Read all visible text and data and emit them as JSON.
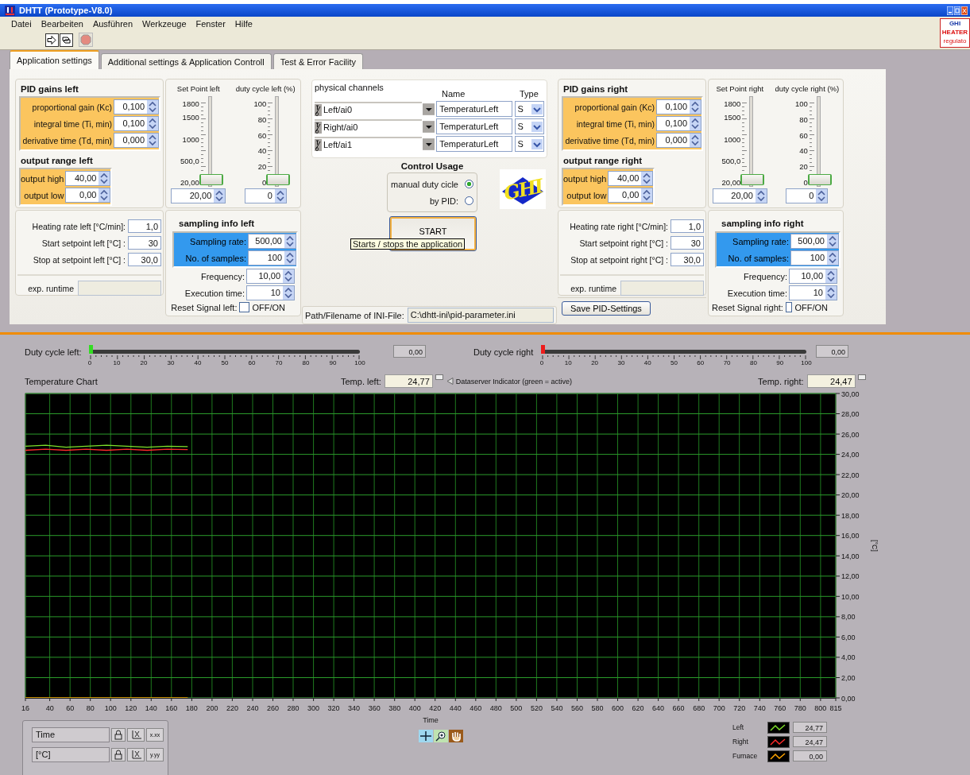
{
  "window": {
    "title": "DHTT (Prototype-V8.0)"
  },
  "menu": [
    "Datei",
    "Bearbeiten",
    "Ausführen",
    "Werkzeuge",
    "Fenster",
    "Hilfe"
  ],
  "corner_logo": {
    "lines": [
      "GHI",
      "HEATER",
      "regulato"
    ]
  },
  "tabs": [
    {
      "label": "Application settings",
      "selected": true
    },
    {
      "label": "Additional settings & Application Controll",
      "selected": false
    },
    {
      "label": "Test & Error Facility",
      "selected": false
    }
  ],
  "sides": [
    {
      "pid_title": "PID gains left",
      "gains": [
        {
          "label": "proportional gain (Kc)",
          "value": "0,100"
        },
        {
          "label": "integral time (Ti, min)",
          "value": "0,100"
        },
        {
          "label": "derivative time (Td, min)",
          "value": "0,000"
        }
      ],
      "output_title": "output range left",
      "outputs": [
        {
          "label": "output high",
          "value": "40,00"
        },
        {
          "label": "output low",
          "value": "0,00"
        }
      ],
      "sliders": [
        {
          "label": "Set Point left",
          "ticks": [
            "1800",
            "1500",
            "1000",
            "500,0",
            "20,00"
          ],
          "level": 0,
          "value": "20,00"
        },
        {
          "label": "duty cycle left (%)",
          "ticks": [
            "100",
            "80",
            "60",
            "40",
            "20",
            "0"
          ],
          "level": 0,
          "value": "0"
        }
      ],
      "rates": [
        {
          "label": "Heating rate left [°C/min]:",
          "value": "1,0"
        },
        {
          "label": "Start setpoint left [°C] :",
          "value": "30"
        },
        {
          "label": "Stop at setpoint left [°C] :",
          "value": "30,0"
        }
      ],
      "runtime_label": "exp. runtime",
      "sampling_title": "sampling info left",
      "sampling": [
        {
          "label": "Sampling rate:",
          "value": "500,00"
        },
        {
          "label": "No. of samples:",
          "value": "100"
        }
      ],
      "timing": [
        {
          "label": "Frequency:",
          "value": "10,00"
        },
        {
          "label": "Execution time:",
          "value": "10"
        }
      ],
      "reset": {
        "label": "Reset Signal left:",
        "option": "OFF/ON",
        "checked": false
      }
    },
    {
      "pid_title": "PID gains right",
      "gains": [
        {
          "label": "proportional gain (Kc)",
          "value": "0,100"
        },
        {
          "label": "integral time (Ti, min)",
          "value": "0,100"
        },
        {
          "label": "derivative time (Td, min)",
          "value": "0,000"
        }
      ],
      "output_title": "output range right",
      "outputs": [
        {
          "label": "output high",
          "value": "40,00"
        },
        {
          "label": "output low",
          "value": "0,00"
        }
      ],
      "sliders": [
        {
          "label": "Set Point right",
          "ticks": [
            "1800",
            "1500",
            "1000",
            "500,0",
            "20,00"
          ],
          "level": 0,
          "value": "20,00"
        },
        {
          "label": "duty cycle right (%)",
          "ticks": [
            "100",
            "80",
            "60",
            "40",
            "20",
            "0"
          ],
          "level": 0,
          "value": "0"
        }
      ],
      "rates": [
        {
          "label": "Heating rate right [°C/min]:",
          "value": "1,0"
        },
        {
          "label": "Start setpoint right [°C] :",
          "value": "30"
        },
        {
          "label": "Stop at setpoint right [°C] :",
          "value": "30,0"
        }
      ],
      "runtime_label": "exp. runtime",
      "button": "Save PID-Settings",
      "sampling_title": "sampling info right",
      "sampling": [
        {
          "label": "Sampling rate:",
          "value": "500,00"
        },
        {
          "label": "No. of samples:",
          "value": "100"
        }
      ],
      "timing": [
        {
          "label": "Frequency:",
          "value": "10,00"
        },
        {
          "label": "Execution time:",
          "value": "10"
        }
      ],
      "reset": {
        "label": "Reset Signal right:",
        "option": "OFF/ON",
        "checked": false
      }
    }
  ],
  "channels": {
    "title": "physical channels",
    "name_header": "Name",
    "type_header": "Type",
    "rows": [
      {
        "channel": "Left/ai0",
        "name": "TemperaturLeft",
        "type": "S"
      },
      {
        "channel": "Right/ai0",
        "name": "TemperaturLeft",
        "type": "S"
      },
      {
        "channel": "Left/ai1",
        "name": "TemperaturLeft",
        "type": "S"
      }
    ]
  },
  "control_usage": {
    "title": "Control Usage",
    "options": [
      {
        "label": "manual duty cicle",
        "selected": true
      },
      {
        "label": "by PID:",
        "selected": false
      }
    ]
  },
  "brand_logo": {
    "text": "GHI"
  },
  "start_button": {
    "label": "START"
  },
  "tooltip": {
    "text": "Starts / stops the application"
  },
  "ini": {
    "label": "Path/Filename of INI-File:",
    "value": "C:\\dhtt-ini\\pid-parameter.ini"
  },
  "duty_meters": [
    {
      "label": "Duty cycle left:",
      "level": 0,
      "color": "#33dd22",
      "ticks": [
        "0",
        "10",
        "20",
        "30",
        "40",
        "50",
        "60",
        "70",
        "80",
        "90",
        "100"
      ],
      "value": "0,00"
    },
    {
      "label": "Duty cycle right",
      "level": 0,
      "color": "#ee1c1c",
      "ticks": [
        "0",
        "10",
        "20",
        "30",
        "40",
        "50",
        "60",
        "70",
        "80",
        "90",
        "100"
      ],
      "value": "0,00"
    }
  ],
  "chart_title": "Temperature Chart",
  "temp_left": {
    "label": "Temp. left:",
    "value": "24,77"
  },
  "indicator": {
    "label": "Dataserver Indicator (green = active)"
  },
  "temp_right": {
    "label": "Temp. right:",
    "value": "24,47"
  },
  "chart": {
    "chart_data": {
      "type": "line",
      "xlabel": "Time",
      "ylabel": "[°C]",
      "x": [
        16,
        36,
        56,
        76,
        96,
        116,
        136,
        156,
        176
      ],
      "series": [
        {
          "name": "Left",
          "color": "#7ee02a",
          "values": [
            24.8,
            24.9,
            24.7,
            24.8,
            24.9,
            24.8,
            24.7,
            24.8,
            24.77
          ]
        },
        {
          "name": "Right",
          "color": "#ff2a2a",
          "values": [
            24.4,
            24.5,
            24.4,
            24.5,
            24.4,
            24.5,
            24.4,
            24.5,
            24.47
          ]
        },
        {
          "name": "Furnace",
          "color": "#ffa500",
          "values": [
            0,
            0,
            0,
            0,
            0,
            0,
            0,
            0,
            0
          ]
        }
      ],
      "xlim": [
        16,
        815
      ],
      "ylim": [
        0,
        30
      ],
      "grid": true,
      "xticks": [
        16,
        40,
        60,
        80,
        100,
        120,
        140,
        160,
        180,
        200,
        220,
        240,
        260,
        280,
        300,
        320,
        340,
        360,
        380,
        400,
        420,
        440,
        460,
        480,
        500,
        520,
        540,
        560,
        580,
        600,
        620,
        640,
        660,
        680,
        700,
        720,
        740,
        760,
        780,
        800,
        815
      ],
      "yticks": [
        {
          "value": 0,
          "label": "0,00"
        },
        {
          "value": 2,
          "label": "2,00"
        },
        {
          "value": 4,
          "label": "4,00"
        },
        {
          "value": 6,
          "label": "6,00"
        },
        {
          "value": 8,
          "label": "8,00"
        },
        {
          "value": 10,
          "label": "10,00"
        },
        {
          "value": 12,
          "label": "12,00"
        },
        {
          "value": 14,
          "label": "14,00"
        },
        {
          "value": 16,
          "label": "16,00"
        },
        {
          "value": 18,
          "label": "18,00"
        },
        {
          "value": 20,
          "label": "20,00"
        },
        {
          "value": 22,
          "label": "22,00"
        },
        {
          "value": 24,
          "label": "24,00"
        },
        {
          "value": 26,
          "label": "26,00"
        },
        {
          "value": 28,
          "label": "28,00"
        },
        {
          "value": 30,
          "label": "30,00"
        }
      ]
    }
  },
  "legend": [
    {
      "value": "24,77"
    },
    {
      "value": "24,47"
    },
    {
      "value": "0,00"
    }
  ],
  "scales": [
    {
      "label": "Time",
      "format": "x.xx"
    },
    {
      "label": "[°C]",
      "format": "y.yy"
    }
  ]
}
